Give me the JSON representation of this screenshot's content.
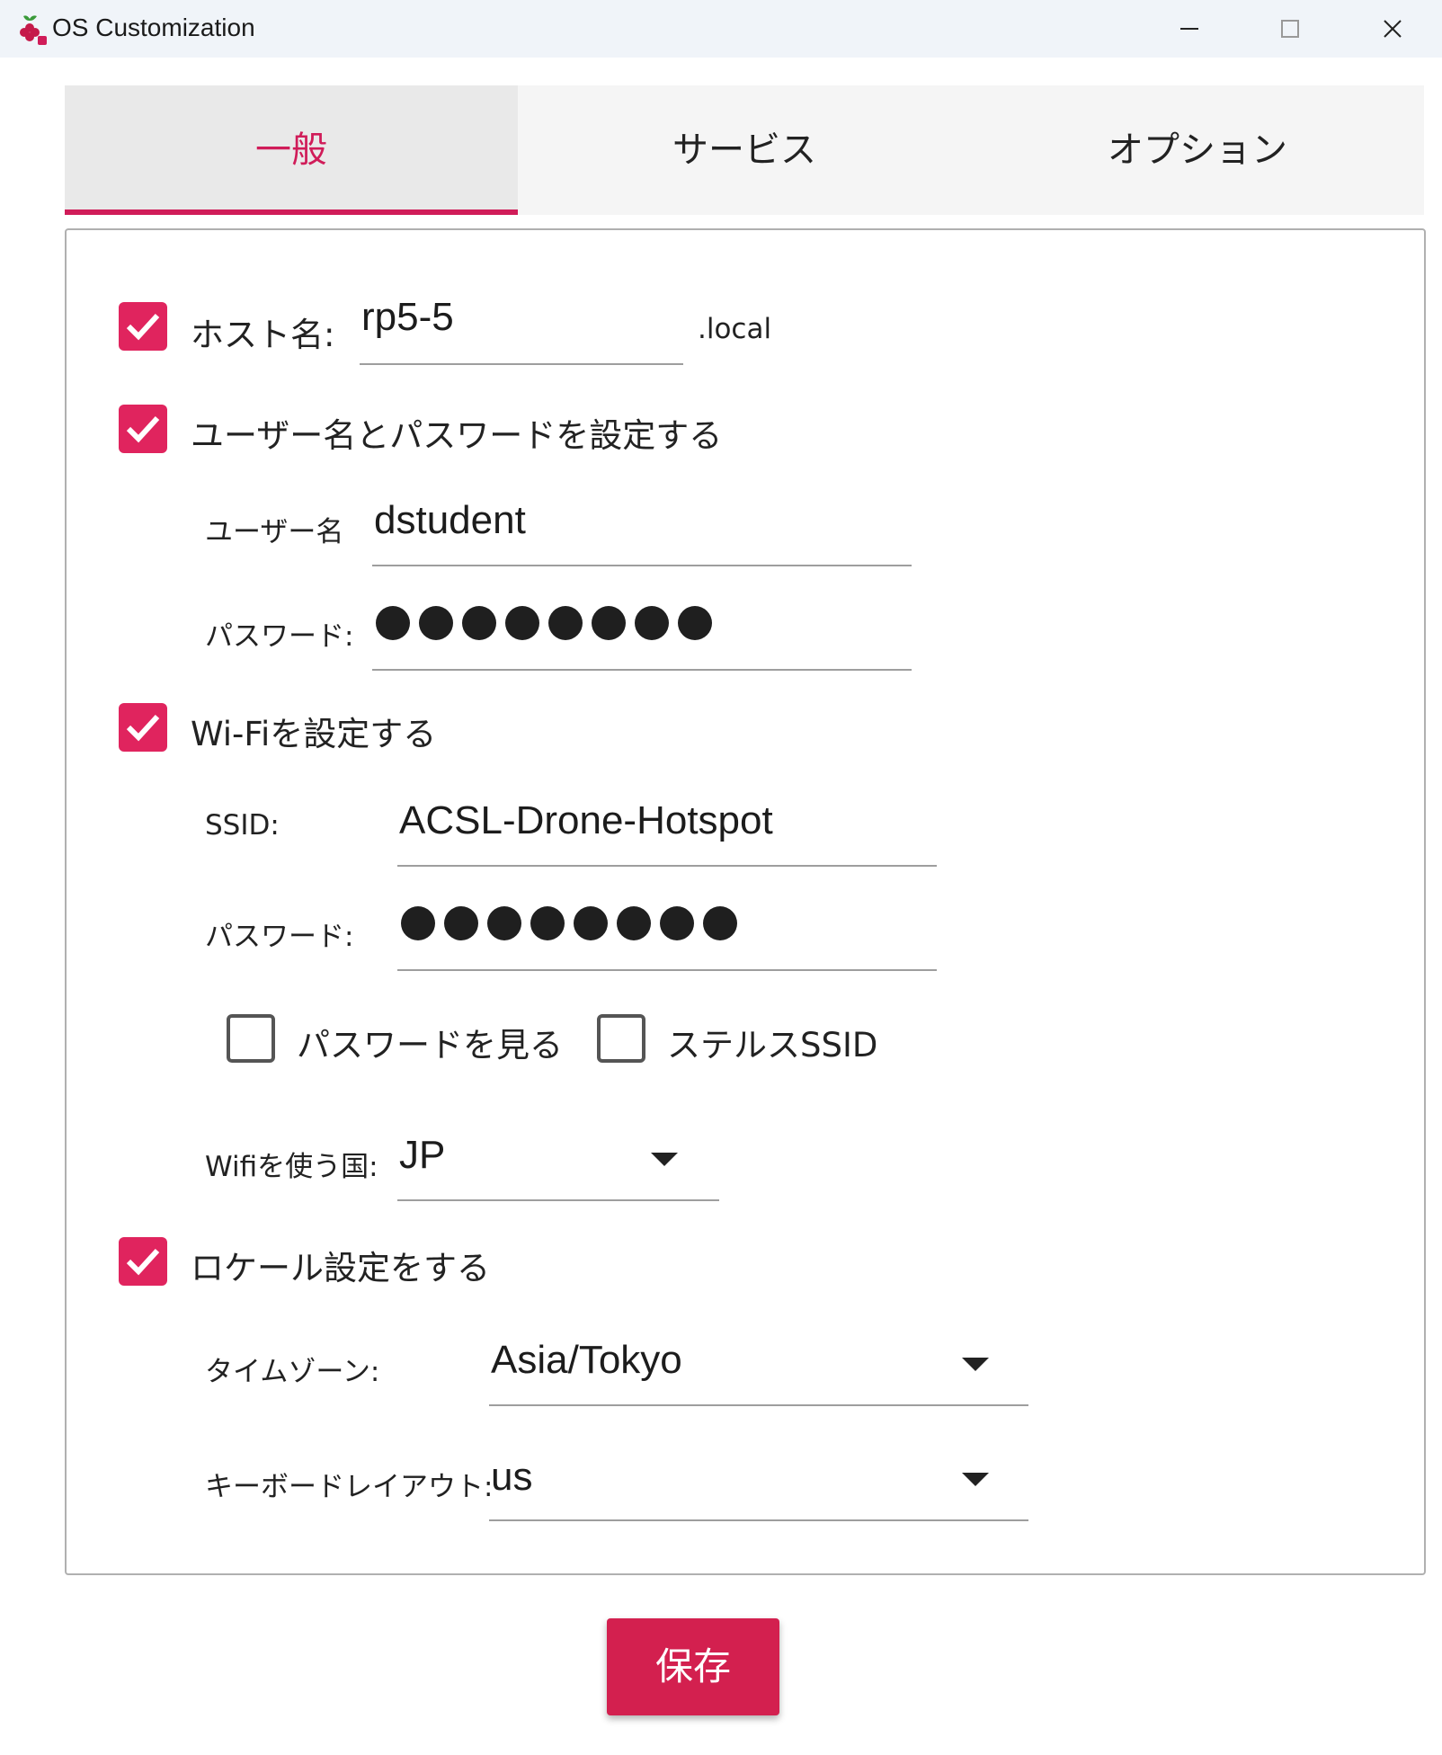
{
  "window": {
    "title": "OS Customization",
    "icon": "raspberry-pi-icon",
    "controls": [
      "minimize-icon",
      "maximize-icon",
      "close-icon"
    ]
  },
  "tabs": [
    {
      "label": "一般",
      "active": true
    },
    {
      "label": "サービス",
      "active": false
    },
    {
      "label": "オプション",
      "active": false
    }
  ],
  "hostname": {
    "checked": true,
    "label": "ホスト名:",
    "value": "rp5-5",
    "suffix": ".local"
  },
  "user": {
    "checked": true,
    "label": "ユーザー名とパスワードを設定する",
    "username_label": "ユーザー名",
    "username_value": "dstudent",
    "password_label": "パスワード:",
    "password_length": 8
  },
  "wifi": {
    "checked": true,
    "label": "Wi-Fiを設定する",
    "ssid_label": "SSID:",
    "ssid_value": "ACSL-Drone-Hotspot",
    "password_label": "パスワード:",
    "password_length": 8,
    "show_password_label": "パスワードを見る",
    "show_password_checked": false,
    "hidden_ssid_label": "ステルスSSID",
    "hidden_ssid_checked": false,
    "country_label": "Wifiを使う国:",
    "country_value": "JP"
  },
  "locale": {
    "checked": true,
    "label": "ロケール設定をする",
    "timezone_label": "タイムゾーン:",
    "timezone_value": "Asia/Tokyo",
    "keyboard_label": "キーボードレイアウト:",
    "keyboard_value": "us"
  },
  "save_label": "保存",
  "colors": {
    "accent": "#d01c59",
    "checkbox": "#e0245e",
    "button": "#d3204f"
  }
}
